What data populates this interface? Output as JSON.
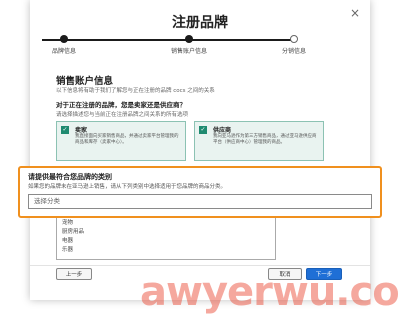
{
  "dialog": {
    "title": "注册品牌",
    "close": "×"
  },
  "steps": [
    {
      "label": "品牌信息",
      "state": "done"
    },
    {
      "label": "销售账户信息",
      "state": "done"
    },
    {
      "label": "分销信息",
      "state": "todo"
    }
  ],
  "section": {
    "title": "销售账户信息",
    "subtitle": "以下信息将有助于我们了解您与正在注册的品牌 cocs 之间的关系"
  },
  "question": {
    "title": "对于正在注册的品牌，您是卖家还是供应商？",
    "subtitle": "请选择描述您与当前正在注册品牌之间关系的所有选项"
  },
  "cards": [
    {
      "title": "卖家",
      "description": "我直接面向买家销售商品，并通过卖家平台管理我的商品和库存（卖家中心）。"
    },
    {
      "title": "供应商",
      "description": "我向亚马逊作为第三方销售商品，通过亚马逊供应商平台（供应商中心）管理我的商品。"
    }
  ],
  "category": {
    "title": "请提供最符合您品牌的类别",
    "subtitle": "如果您的品牌未在亚马逊上销售，请从下列类别中选择适用于您品牌的商品分类。",
    "placeholder": "选择分类",
    "options": [
      "宠物",
      "厨房用品",
      "电器",
      "乐器"
    ]
  },
  "buttons": {
    "prev": "上一步",
    "cancel": "取消",
    "next": "下一步"
  },
  "watermark": "awyerwu.com",
  "colors": {
    "accent": "#1f6fd6",
    "highlight_border": "#f0901e",
    "card_bg": "#e9f3f0",
    "check": "#1f8a70",
    "watermark": "#e83e28"
  }
}
